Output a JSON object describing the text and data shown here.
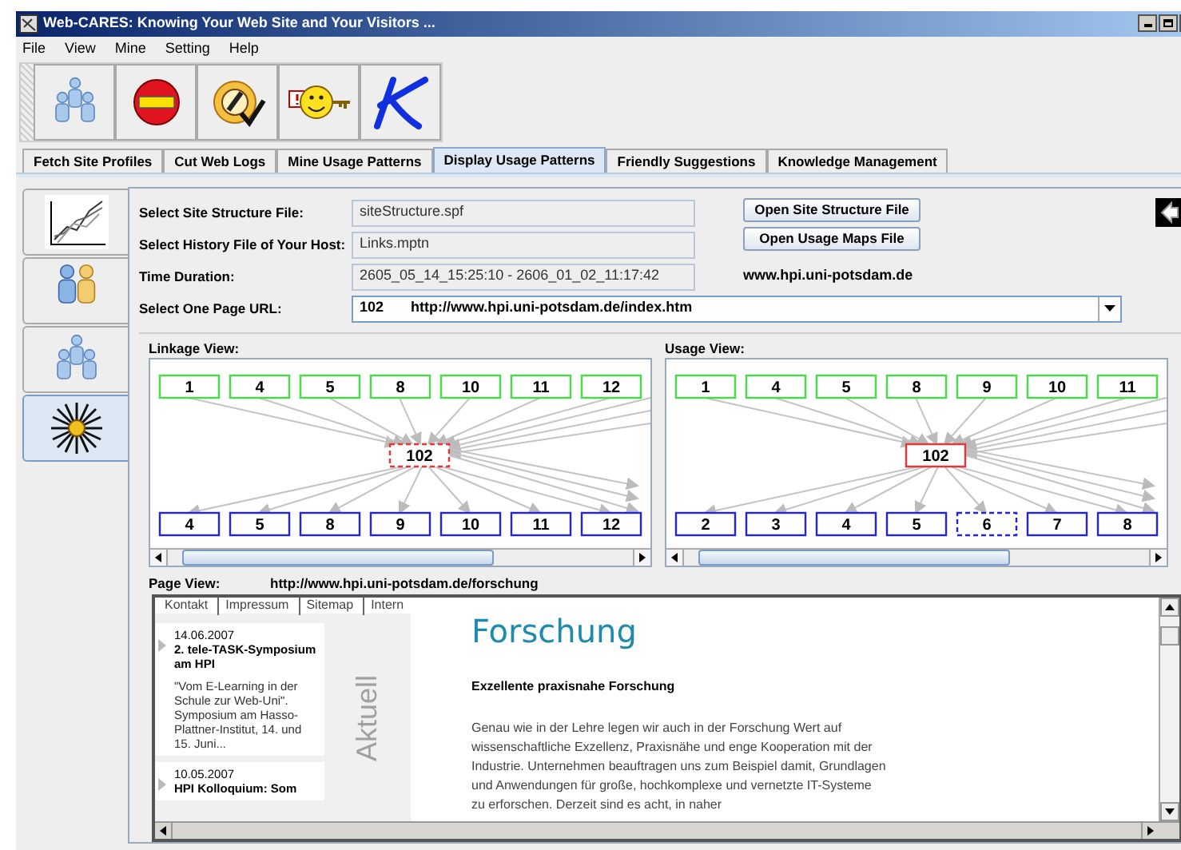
{
  "window": {
    "title": "Web-CARES: Knowing Your Web Site and Your Visitors ..."
  },
  "menu": [
    "File",
    "View",
    "Mine",
    "Setting",
    "Help"
  ],
  "toolbar": [
    {
      "kind": "users"
    },
    {
      "kind": "stop"
    },
    {
      "kind": "gauge"
    },
    {
      "kind": "smiley"
    },
    {
      "kind": "logo"
    }
  ],
  "tabs": [
    {
      "label": "Fetch Site Profiles",
      "selected": false
    },
    {
      "label": "Cut Web Logs",
      "selected": false
    },
    {
      "label": "Mine Usage Patterns",
      "selected": false
    },
    {
      "label": "Display Usage Patterns",
      "selected": true
    },
    {
      "label": "Friendly Suggestions",
      "selected": false
    },
    {
      "label": "Knowledge Management",
      "selected": false
    }
  ],
  "side_tabs": [
    {
      "kind": "chart",
      "selected": false
    },
    {
      "kind": "pair",
      "selected": false
    },
    {
      "kind": "group",
      "selected": false
    },
    {
      "kind": "star",
      "selected": true
    }
  ],
  "form": {
    "site_structure": {
      "label": "Select Site Structure File:",
      "value": "siteStructure.spf"
    },
    "history": {
      "label": "Select History File of Your Host:",
      "value": "Links.mptn"
    },
    "duration": {
      "label": "Time Duration:",
      "value": "2605_05_14_15:25:10 - 2606_01_02_11:17:42"
    },
    "page_url": {
      "label": "Select One Page URL:",
      "id": "102",
      "url": "http://www.hpi.uni-potsdam.de/index.htm"
    }
  },
  "buttons": [
    "Open Site Structure File",
    "Open Usage Maps File"
  ],
  "site_name": "www.hpi.uni-potsdam.de",
  "linkage_view": {
    "title": "Linkage View:",
    "center": {
      "label": "102",
      "dashed": true
    },
    "incoming": [
      {
        "label": "1",
        "dashed": false
      },
      {
        "label": "4",
        "dashed": false
      },
      {
        "label": "5",
        "dashed": false
      },
      {
        "label": "8",
        "dashed": false
      },
      {
        "label": "10",
        "dashed": false
      },
      {
        "label": "11",
        "dashed": false
      },
      {
        "label": "12",
        "dashed": false
      }
    ],
    "outgoing": [
      {
        "label": "4",
        "dashed": false
      },
      {
        "label": "5",
        "dashed": false
      },
      {
        "label": "8",
        "dashed": false
      },
      {
        "label": "9",
        "dashed": false
      },
      {
        "label": "10",
        "dashed": false
      },
      {
        "label": "11",
        "dashed": false
      },
      {
        "label": "12",
        "dashed": false
      }
    ]
  },
  "usage_view": {
    "title": "Usage View:",
    "center": {
      "label": "102",
      "dashed": false
    },
    "incoming": [
      {
        "label": "1",
        "dashed": false
      },
      {
        "label": "4",
        "dashed": false
      },
      {
        "label": "5",
        "dashed": false
      },
      {
        "label": "8",
        "dashed": false
      },
      {
        "label": "9",
        "dashed": false
      },
      {
        "label": "10",
        "dashed": false
      },
      {
        "label": "11",
        "dashed": false
      }
    ],
    "outgoing": [
      {
        "label": "2",
        "dashed": false
      },
      {
        "label": "3",
        "dashed": false
      },
      {
        "label": "4",
        "dashed": false
      },
      {
        "label": "5",
        "dashed": false
      },
      {
        "label": "6",
        "dashed": true
      },
      {
        "label": "7",
        "dashed": false
      },
      {
        "label": "8",
        "dashed": false
      }
    ]
  },
  "page_view": {
    "title": "Page View:",
    "url": "http://www.hpi.uni-potsdam.de/forschung",
    "nav": [
      "Kontakt",
      "Impressum",
      "Sitemap",
      "Intern"
    ],
    "news": [
      {
        "date": "14.06.2007",
        "title": "2. tele-TASK-Symposium am HPI",
        "text": "\"Vom E-Learning in der Schule zur Web-Uni\". Symposium am Hasso-Plattner-Institut, 14. und 15. Juni..."
      },
      {
        "date": "10.05.2007",
        "title": "HPI Kolloquium: Som"
      }
    ],
    "side_label": "Aktuell",
    "heading": "Forschung",
    "subheading": "Exzellente praxisnahe Forschung",
    "body": "Genau wie in der Lehre legen wir auch in der Forschung Wert auf wissenschaftliche Exzellenz, Praxisnähe und enge Kooperation mit der Industrie. Unternehmen beauftragen uns zum Beispiel damit, Grundlagen und Anwendungen für große, hochkomplexe und vernetzte IT-Systeme zu erforschen. Derzeit sind es acht, in naher"
  }
}
